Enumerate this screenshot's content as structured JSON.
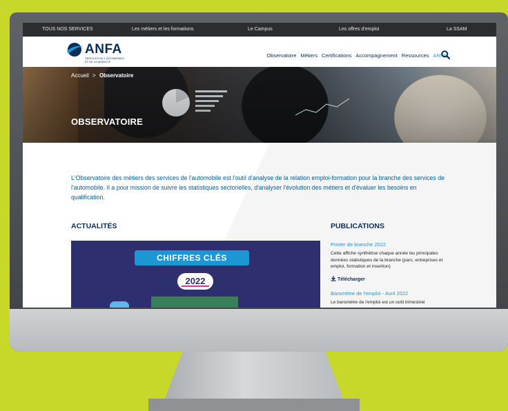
{
  "services_bar": {
    "items": [
      "TOUS NOS SERVICES",
      "Les métiers et les formations",
      "Le Campus",
      "Les offres d'emploi",
      "La SSAM"
    ]
  },
  "header": {
    "logo_text": "ANFA",
    "logo_sub": "SERVICES DE L'AUTOMOBILE ET DE LA MOBILITE",
    "nav": [
      "Observatoire",
      "Métiers",
      "Certifications",
      "Accompagnement",
      "Ressources",
      "ANFA"
    ]
  },
  "hero": {
    "breadcrumb_home": "Accueil",
    "breadcrumb_sep": ">",
    "breadcrumb_current": "Observatoire",
    "title": "OBSERVATOIRE"
  },
  "intro": "L'Observatoire des métiers des services de l'automobile est l'outil d'analyse de la relation emploi-formation pour la branche des services de l'automobile. Il a pour mission de suivre les statistiques sectorielles, d'analyser l'évolution des métiers et d'évaluer les besoins en qualification.",
  "news": {
    "title": "ACTUALITÉS",
    "badge": "CHIFFRES CLÉS",
    "year": "2022"
  },
  "publications": {
    "title": "PUBLICATIONS",
    "items": [
      {
        "title": "Poster de branche 2022",
        "desc": "Cette affiche synthétise chaque année les principales données statistiques de la branche (parc, entreprises et emploi, formation et insertion)",
        "download": "Télécharger"
      },
      {
        "title": "Baromètre de l'emploi - Avril 2022",
        "desc": "Le baromètre de l'emploi est un outil trimestriel"
      }
    ]
  },
  "colors": {
    "background": "#c8d82a",
    "navy": "#0b2d58",
    "accent": "#1d97d4",
    "services_bar": "#2b2d2f"
  }
}
